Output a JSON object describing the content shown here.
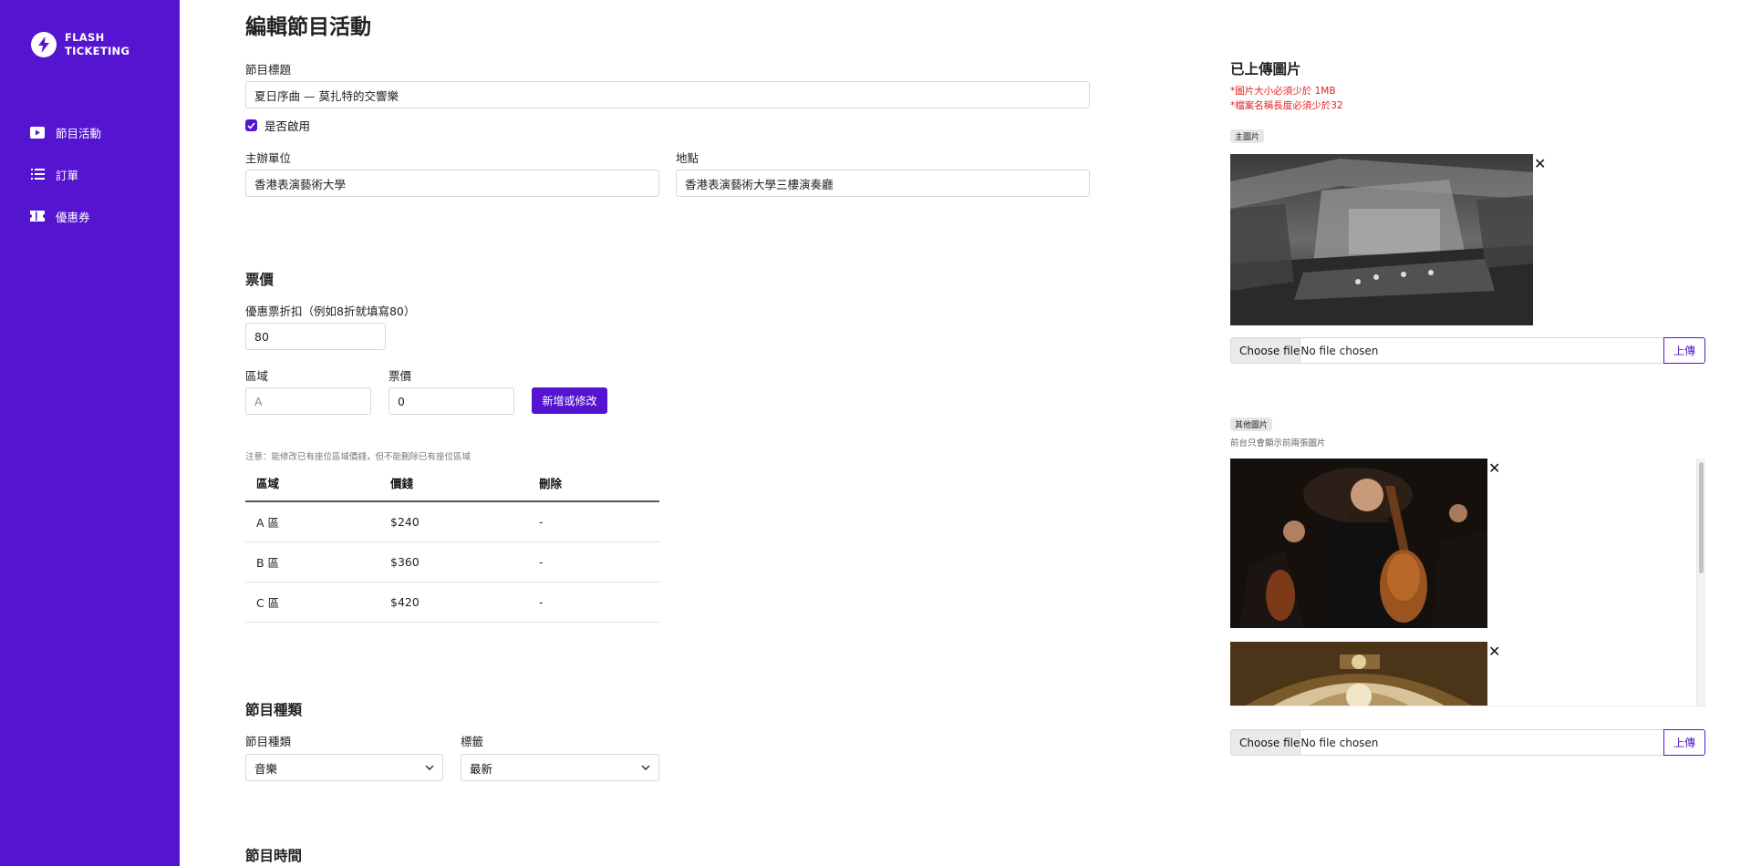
{
  "brand": {
    "line1": "FLASH",
    "line2": "TICKETING"
  },
  "colors": {
    "primary": "#5515d0",
    "warning": "#e02424"
  },
  "nav": {
    "items": [
      {
        "label": "節目活動",
        "icon": "play-icon"
      },
      {
        "label": "訂單",
        "icon": "list-icon"
      },
      {
        "label": "優惠券",
        "icon": "ticket-icon"
      }
    ]
  },
  "page": {
    "title": "編輯節目活動"
  },
  "form": {
    "title_label": "節目標題",
    "title_value": "夏日序曲 — 莫扎特的交響樂",
    "enabled_label": "是否啟用",
    "organizer_label": "主辦單位",
    "organizer_value": "香港表演藝術大學",
    "location_label": "地點",
    "location_value": "香港表演藝術大學三樓演奏廳"
  },
  "pricing": {
    "section_title": "票價",
    "discount_label": "優惠票折扣（例如8折就填寫80）",
    "discount_value": "80",
    "zone_label": "區域",
    "zone_placeholder": "A",
    "price_label": "票價",
    "price_value": "0",
    "add_button": "新增或修改",
    "note": "注意：能修改已有座位區域價錢，但不能刪除已有座位區域",
    "table": {
      "headers": {
        "zone": "區域",
        "price": "價錢",
        "delete": "刪除"
      },
      "rows": [
        {
          "zone": "A 區",
          "price": "$240",
          "delete": "-"
        },
        {
          "zone": "B 區",
          "price": "$360",
          "delete": "-"
        },
        {
          "zone": "C 區",
          "price": "$420",
          "delete": "-"
        }
      ]
    }
  },
  "category": {
    "section_title": "節目種類",
    "type_label": "節目種類",
    "type_value": "音樂",
    "tag_label": "標籤",
    "tag_value": "最新"
  },
  "time": {
    "section_title": "節目時間"
  },
  "images": {
    "title": "已上傳圖片",
    "warning1": "*圖片大小必須少於 1MB",
    "warning2": "*檔案名稱長度必須少於32",
    "main_tag": "主圖片",
    "other_tag": "其他圖片",
    "other_hint": "前台只會顯示前兩張圖片",
    "file_choose": "Choose file",
    "file_status": "No file chosen",
    "upload_button": "上傳",
    "close": "✕"
  }
}
